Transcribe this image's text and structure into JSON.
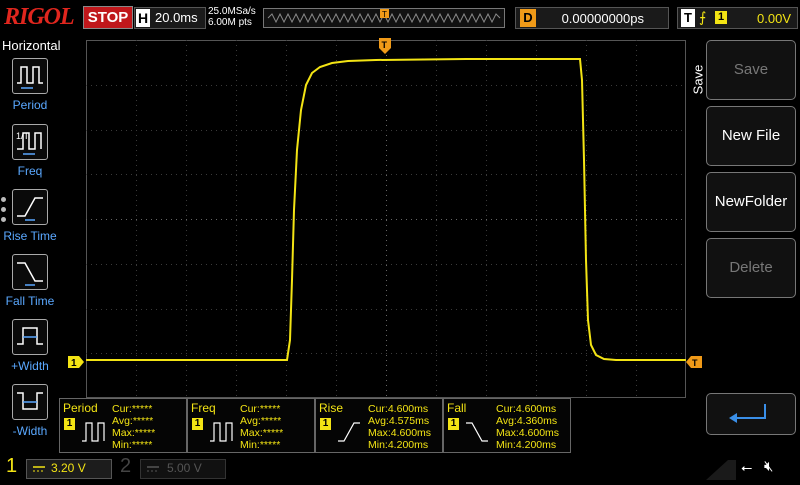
{
  "brand": "RIGOL",
  "run_status": "STOP",
  "horizontal": {
    "label": "H",
    "timebase": "20.0ms"
  },
  "acquisition": {
    "sample_rate": "25.0MSa/s",
    "memory_depth": "6.00M pts"
  },
  "delay": {
    "label": "D",
    "value": "0.00000000ps"
  },
  "trigger": {
    "label": "T",
    "source": "1",
    "level": "0.00V",
    "marker": "T"
  },
  "left_menu": {
    "title": "Horizontal",
    "items": [
      {
        "label": "Period",
        "icon": "period-icon"
      },
      {
        "label": "Freq",
        "icon": "frequency-icon"
      },
      {
        "label": "Rise Time",
        "icon": "rise-time-icon"
      },
      {
        "label": "Fall Time",
        "icon": "fall-time-icon"
      },
      {
        "label": "+Width",
        "icon": "positive-width-icon"
      },
      {
        "label": "-Width",
        "icon": "negative-width-icon"
      }
    ]
  },
  "right_menu": {
    "tab_label": "Save",
    "buttons": [
      {
        "label": "Save",
        "enabled": false
      },
      {
        "label": "New File",
        "enabled": true
      },
      {
        "label": "NewFolder",
        "enabled": true
      },
      {
        "label": "Delete",
        "enabled": false
      }
    ],
    "return_icon": "return-arrow-icon"
  },
  "measurements": [
    {
      "title": "Period",
      "channel": "1",
      "cur": "*****",
      "avg": "*****",
      "max": "*****",
      "min": "*****"
    },
    {
      "title": "Freq",
      "channel": "1",
      "cur": "*****",
      "avg": "*****",
      "max": "*****",
      "min": "*****"
    },
    {
      "title": "Rise",
      "channel": "1",
      "cur": "4.600ms",
      "avg": "4.575ms",
      "max": "4.600ms",
      "min": "4.200ms"
    },
    {
      "title": "Fall",
      "channel": "1",
      "cur": "4.600ms",
      "avg": "4.360ms",
      "max": "4.600ms",
      "min": "4.200ms"
    }
  ],
  "row_labels": {
    "cur": "Cur:",
    "avg": "Avg:",
    "max": "Max:",
    "min": "Min:"
  },
  "channels": [
    {
      "number": "1",
      "scale": "3.20 V",
      "active": true
    },
    {
      "number": "2",
      "scale": "5.00 V",
      "active": false
    }
  ],
  "ch1_marker": "1",
  "colors": {
    "ch1": "#f3e414",
    "trigger": "#f09a18",
    "stop": "#c0171b",
    "menu_label": "#5aa8ff"
  }
}
